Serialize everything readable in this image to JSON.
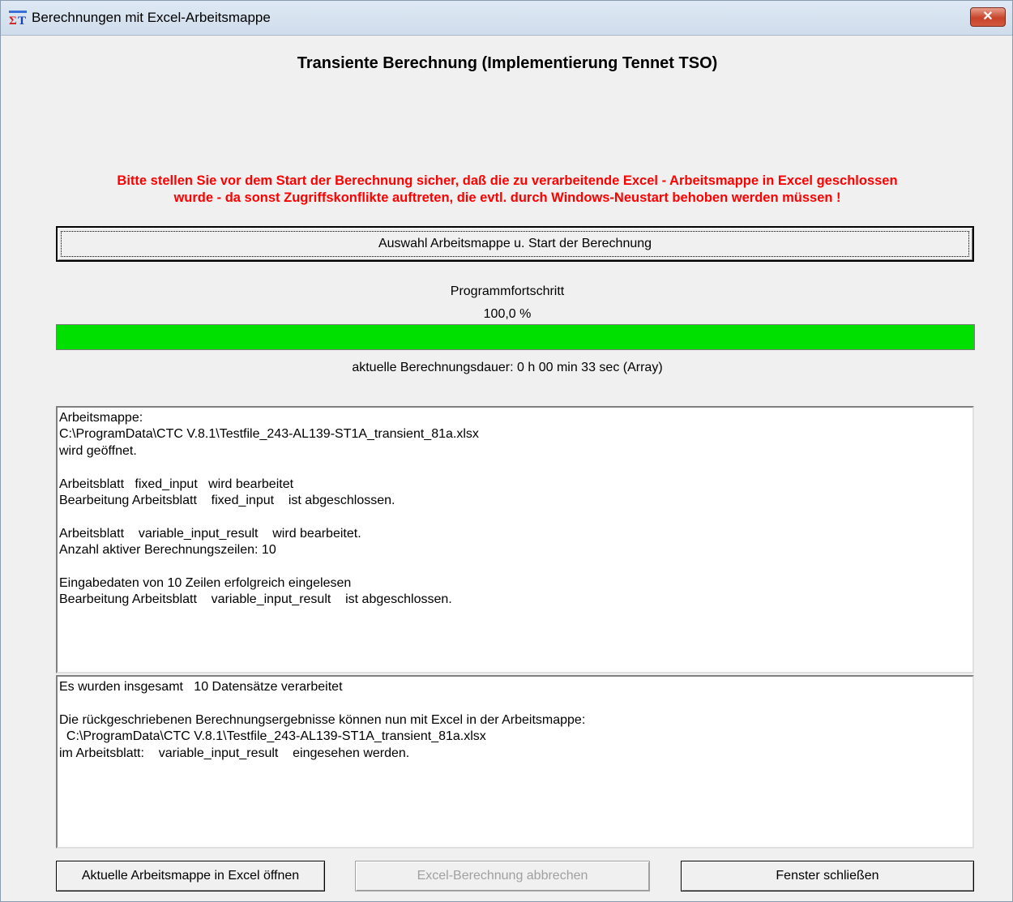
{
  "window": {
    "title": "Berechnungen mit Excel-Arbeitsmappe",
    "close_label": "✕"
  },
  "heading": "Transiente Berechnung (Implementierung Tennet TSO)",
  "warning": {
    "line1": "Bitte stellen Sie vor dem Start der Berechnung sicher, daß die zu verarbeitende Excel - Arbeitsmappe in Excel geschlossen",
    "line2": "wurde - da sonst Zugriffskonflikte auftreten, die evtl. durch Windows-Neustart behoben werden müssen !"
  },
  "start_button": "Auswahl Arbeitsmappe u. Start der Berechnung",
  "progress": {
    "label": "Programmfortschritt",
    "percent_text": "100,0 %",
    "value": 1.0,
    "fill_color": "#00e000"
  },
  "duration": "aktuelle Berechnungsdauer: 0 h 00 min 33 sec (Array)",
  "log1": {
    "lines": [
      "Arbeitsmappe:",
      "C:\\ProgramData\\CTC V.8.1\\Testfile_243-AL139-ST1A_transient_81a.xlsx",
      "wird geöffnet.",
      "",
      "Arbeitsblatt   fixed_input   wird bearbeitet",
      "Bearbeitung Arbeitsblatt    fixed_input    ist abgeschlossen.",
      "",
      "Arbeitsblatt    variable_input_result    wird bearbeitet.",
      "Anzahl aktiver Berechnungszeilen: 10",
      "",
      "Eingabedaten von 10 Zeilen erfolgreich eingelesen",
      "Bearbeitung Arbeitsblatt    variable_input_result    ist abgeschlossen."
    ]
  },
  "log2": {
    "lines": [
      "Es wurden insgesamt   10 Datensätze verarbeitet",
      "",
      "Die rückgeschriebenen Berechnungsergebnisse können nun mit Excel in der Arbeitsmappe:",
      "  C:\\ProgramData\\CTC V.8.1\\Testfile_243-AL139-ST1A_transient_81a.xlsx",
      "im Arbeitsblatt:    variable_input_result    eingesehen werden."
    ]
  },
  "buttons": {
    "open_excel": "Aktuelle Arbeitsmappe in Excel öffnen",
    "abort": "Excel-Berechnung abbrechen",
    "close": "Fenster schließen"
  }
}
